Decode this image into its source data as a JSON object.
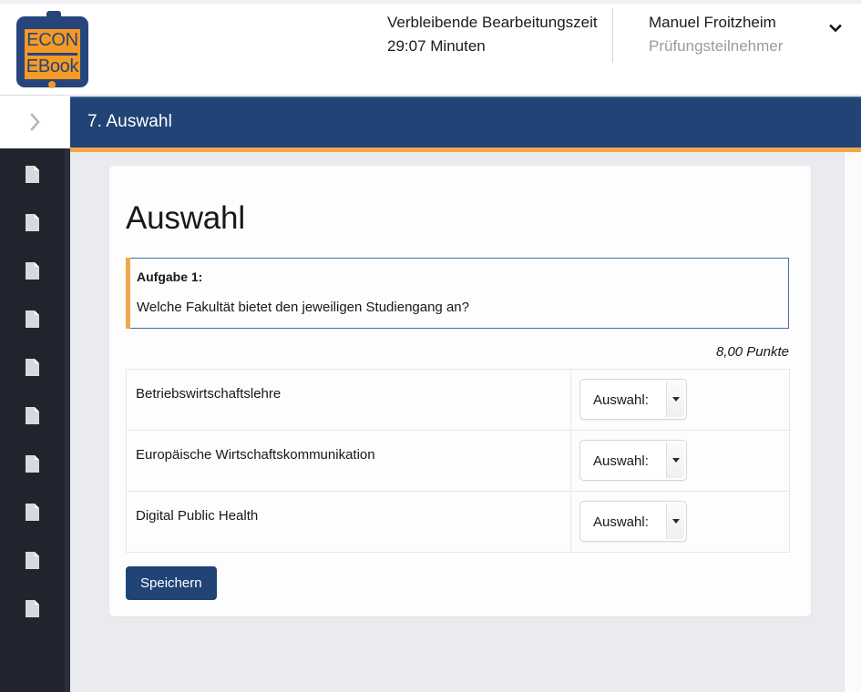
{
  "brand": {
    "logo_line1": "ECON",
    "logo_line2": "EBook",
    "navy": "#27457c",
    "orange": "#f59a23"
  },
  "header": {
    "timer_label": "Verbleibende Bearbeitungszeit",
    "timer_value": "29:07 Minuten",
    "user_name": "Manuel Froitzheim",
    "user_role": "Prüfungsteilnehmer",
    "chevron_icon": "chevron-down-icon"
  },
  "sidebar": {
    "toggle_icon": "chevron-right-icon",
    "item_icon": "document-icon",
    "item_count": 10,
    "background": "#21242e"
  },
  "titlebar": {
    "text": "7. Auswahl",
    "background": "#1f4475",
    "accent": "#f2a74b"
  },
  "main": {
    "card_title": "Auswahl",
    "task": {
      "label": "Aufgabe 1:",
      "question": "Welche Fakultät bietet den jeweiligen Studiengang an?",
      "accent_color": "#f2a74b",
      "border_color": "#4d6d99"
    },
    "points": "8,00 Punkte",
    "table": {
      "rows": [
        {
          "label": "Betriebswirtschaftslehre",
          "select_value": "Auswahl:"
        },
        {
          "label": "Europäische Wirtschaftskommunikation",
          "select_value": "Auswahl:"
        },
        {
          "label": "Digital Public Health",
          "select_value": "Auswahl:"
        }
      ]
    },
    "save_label": "Speichern"
  }
}
